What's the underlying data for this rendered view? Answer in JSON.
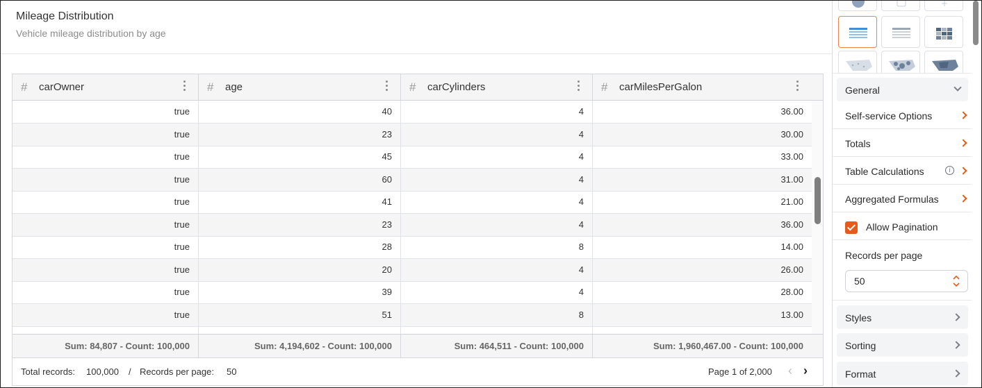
{
  "header": {
    "title": "Mileage Distribution",
    "subtitle": "Vehicle mileage distribution by age"
  },
  "table": {
    "columns": [
      "carOwner",
      "age",
      "carCylinders",
      "carMilesPerGalon"
    ],
    "rows": [
      [
        "true",
        "40",
        "4",
        "36.00"
      ],
      [
        "true",
        "23",
        "4",
        "30.00"
      ],
      [
        "true",
        "45",
        "4",
        "33.00"
      ],
      [
        "true",
        "60",
        "4",
        "31.00"
      ],
      [
        "true",
        "41",
        "4",
        "21.00"
      ],
      [
        "true",
        "23",
        "4",
        "36.00"
      ],
      [
        "true",
        "28",
        "8",
        "14.00"
      ],
      [
        "true",
        "20",
        "4",
        "26.00"
      ],
      [
        "true",
        "39",
        "4",
        "28.00"
      ],
      [
        "true",
        "51",
        "8",
        "13.00"
      ]
    ],
    "totals": [
      "Sum: 84,807 - Count: 100,000",
      "Sum: 4,194,602 - Count: 100,000",
      "Sum: 464,511 - Count: 100,000",
      "Sum: 1,960,467.00 - Count: 100,000"
    ]
  },
  "pager": {
    "total_label": "Total records:",
    "total_value": "100,000",
    "sep": "/",
    "per_page_label": "Records per page:",
    "per_page_value": "50",
    "page_info": "Page 1 of 2,000"
  },
  "sidebar": {
    "general": "General",
    "items": [
      "Self-service Options",
      "Totals",
      "Table Calculations",
      "Aggregated Formulas"
    ],
    "allow_pagination": "Allow Pagination",
    "records_per_page_label": "Records per page",
    "records_per_page_value": "50",
    "sections": [
      "Styles",
      "Sorting",
      "Format"
    ]
  },
  "colors": {
    "accent": "#e65a1c",
    "selected_border": "#e8864a",
    "row_alt": "#f5f5f6"
  }
}
